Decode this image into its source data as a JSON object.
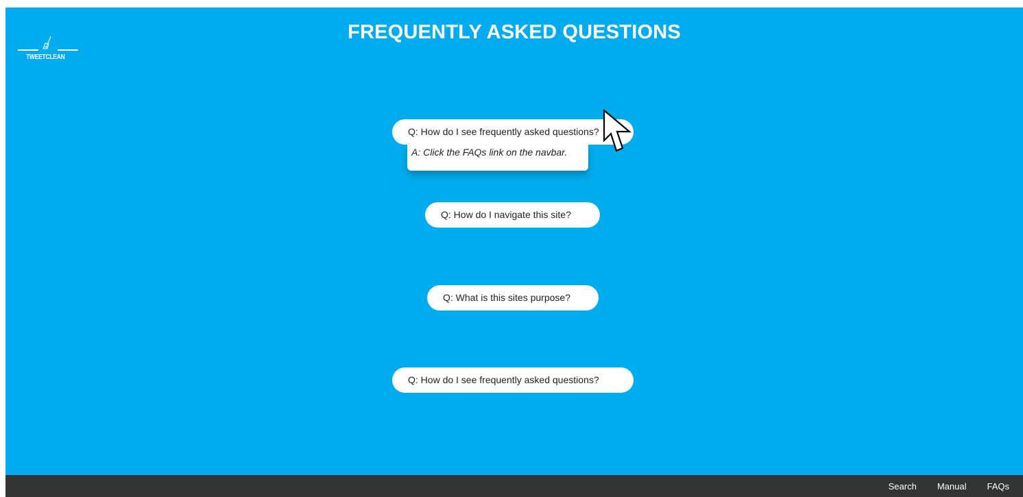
{
  "brand": {
    "logo_text": "TWEETCLEAN",
    "logo_icon": "broom-icon"
  },
  "page": {
    "title": "FREQUENTLY ASKED QUESTIONS"
  },
  "faqs": [
    {
      "question": "Q: How do I see frequently asked questions?",
      "answer": "A: Click the FAQs link on the navbar.",
      "expanded": true
    },
    {
      "question": "Q: How do I navigate this site?",
      "expanded": false
    },
    {
      "question": "Q: What is this sites purpose?",
      "expanded": false
    },
    {
      "question": "Q: How do I see frequently asked questions?",
      "expanded": false
    }
  ],
  "footer": {
    "nav": [
      {
        "label": "Search"
      },
      {
        "label": "Manual"
      },
      {
        "label": "FAQs"
      }
    ]
  },
  "colors": {
    "background": "#00aced",
    "footer": "#333333",
    "card": "#ffffff",
    "text": "#222222"
  },
  "pointer": "mouse-pointer-icon"
}
